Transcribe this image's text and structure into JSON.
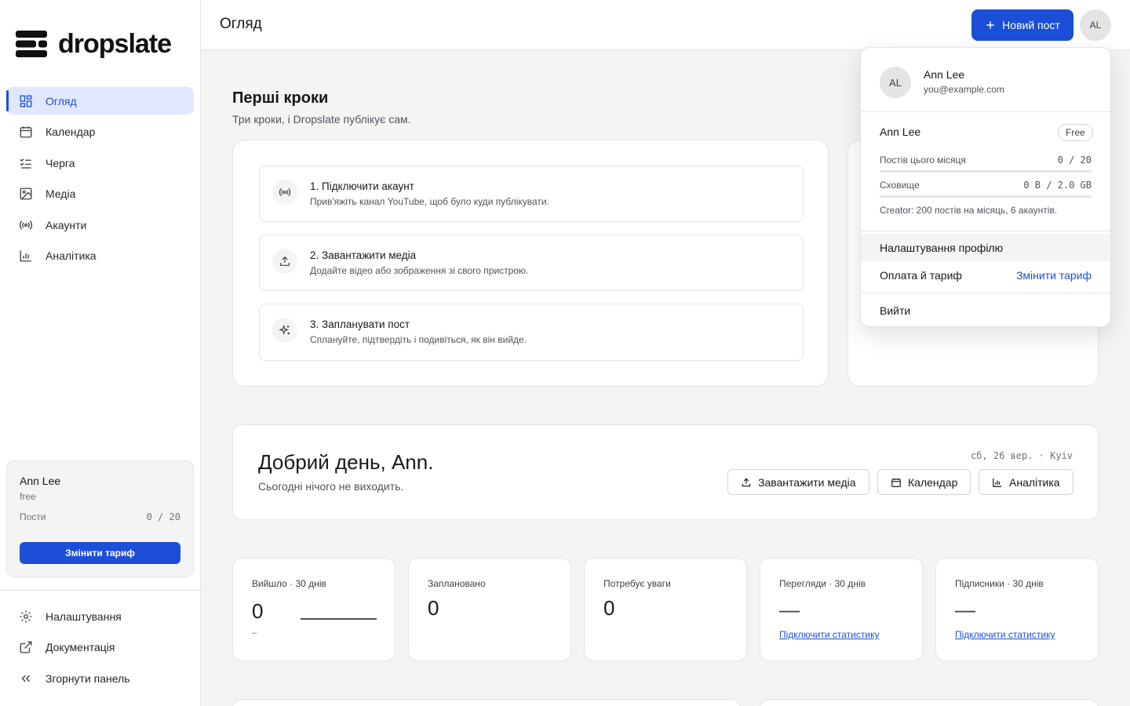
{
  "brand": {
    "name": "dropslate",
    "accent": "#1d4ed8"
  },
  "sidebar": {
    "items": [
      {
        "label": "Огляд",
        "icon": "dashboard-icon",
        "active": true
      },
      {
        "label": "Календар",
        "icon": "calendar-icon"
      },
      {
        "label": "Черга",
        "icon": "queue-icon"
      },
      {
        "label": "Медіа",
        "icon": "image-icon"
      },
      {
        "label": "Акаунти",
        "icon": "broadcast-icon"
      },
      {
        "label": "Аналітика",
        "icon": "bar-chart-icon"
      }
    ],
    "plan": {
      "user": "Ann Lee",
      "tier": "free",
      "posts_label": "Пости",
      "posts_value": "0 / 20",
      "upgrade_label": "Змінити тариф"
    },
    "bottom": [
      {
        "label": "Налаштування",
        "icon": "gear-icon"
      },
      {
        "label": "Документація",
        "icon": "external-link-icon"
      },
      {
        "label": "Згорнути панель",
        "icon": "chevrons-left-icon"
      }
    ]
  },
  "header": {
    "title": "Огляд",
    "new_post_label": "Новий пост",
    "avatar_initials": "AL"
  },
  "first_steps": {
    "title": "Перші кроки",
    "subtitle": "Три кроки, і Dropslate публікує сам.",
    "steps": [
      {
        "title": "1. Підключити акаунт",
        "desc": "Прив'яжіть канал YouTube, щоб було куди публікувати.",
        "icon": "broadcast-icon"
      },
      {
        "title": "2. Завантажити медіа",
        "desc": "Додайте відео або зображення зі свого пристрою.",
        "icon": "upload-icon"
      },
      {
        "title": "3. Запланувати пост",
        "desc": "Сплануйте, підтвердіть і подивіться, як він вийде.",
        "icon": "sparkles-icon"
      }
    ]
  },
  "greeting": {
    "title": "Добрий день, Ann.",
    "subtitle": "Сьогодні нічого не виходить.",
    "date": "сб, 26 вер. · Kyiv",
    "buttons": [
      {
        "label": "Завантажити медіа",
        "icon": "upload-icon"
      },
      {
        "label": "Календар",
        "icon": "calendar-icon"
      },
      {
        "label": "Аналітика",
        "icon": "bar-chart-icon"
      }
    ]
  },
  "stats": [
    {
      "label": "Вийшло · 30 днів",
      "value": "0",
      "sub": "–"
    },
    {
      "label": "Заплановано",
      "value": "0"
    },
    {
      "label": "Потребує уваги",
      "value": "0"
    },
    {
      "label": "Перегляди · 30 днів",
      "value": "—",
      "link": "Підключити статистику"
    },
    {
      "label": "Підписники · 30 днів",
      "value": "—",
      "link": "Підключити статистику"
    }
  ],
  "account_menu": {
    "initials": "AL",
    "name": "Ann Lee",
    "email": "you@example.com",
    "plan_name": "Ann Lee",
    "plan_badge": "Free",
    "metrics": [
      {
        "label": "Постів цього місяця",
        "value": "0 / 20",
        "fraction": 0
      },
      {
        "label": "Сховище",
        "value": "0 B / 2.0 GB",
        "fraction": 0
      }
    ],
    "plan_note": "Creator: 200 постів на місяць, 6 акаунтів.",
    "profile_settings": "Налаштування профілю",
    "billing": "Оплата й тариф",
    "change_plan": "Змінити тариф",
    "logout": "Вийти"
  }
}
